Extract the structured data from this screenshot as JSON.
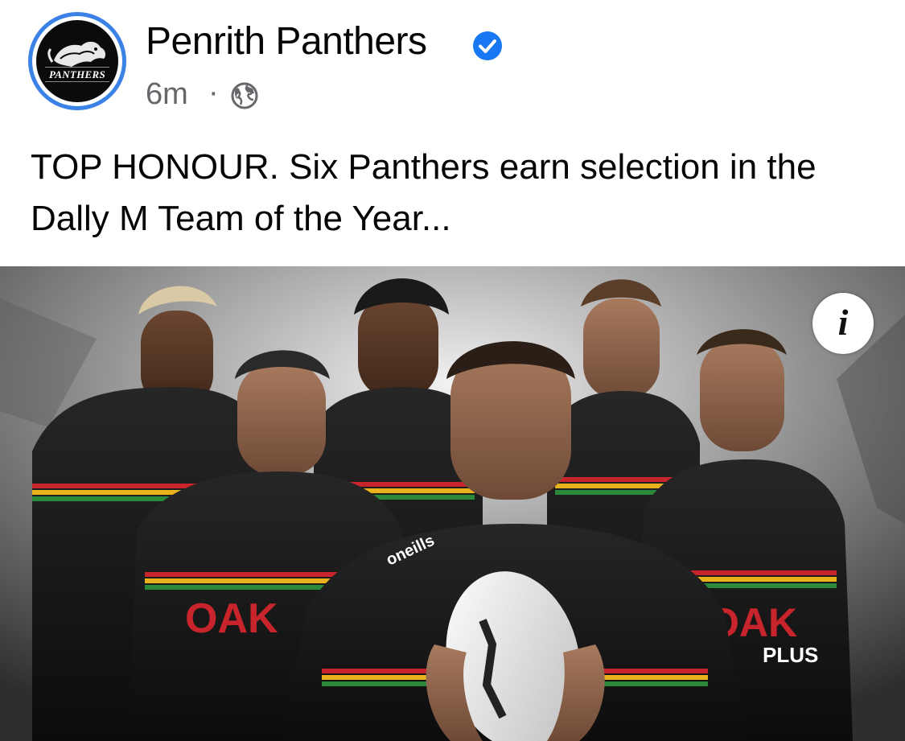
{
  "header": {
    "page_name": "Penrith Panthers",
    "verified_icon": "verified-badge-icon",
    "timestamp": "6m",
    "separator": "·",
    "audience_icon": "globe-icon",
    "avatar_text": "PANTHERS"
  },
  "post": {
    "text": "TOP HONOUR. Six Panthers earn selection in the Dally M Team of the Year..."
  },
  "media": {
    "description_icon": "info-icon",
    "info_glyph": "i",
    "jersey_logo": "OAK",
    "jersey_sponsor_sub": "PLUS",
    "kit_brand": "oneills"
  },
  "colors": {
    "verified_blue": "#1877f2",
    "avatar_ring": "#3b82e6",
    "meta_grey": "#65676b",
    "jersey_black": "#141414",
    "oak_red": "#c8242b"
  }
}
